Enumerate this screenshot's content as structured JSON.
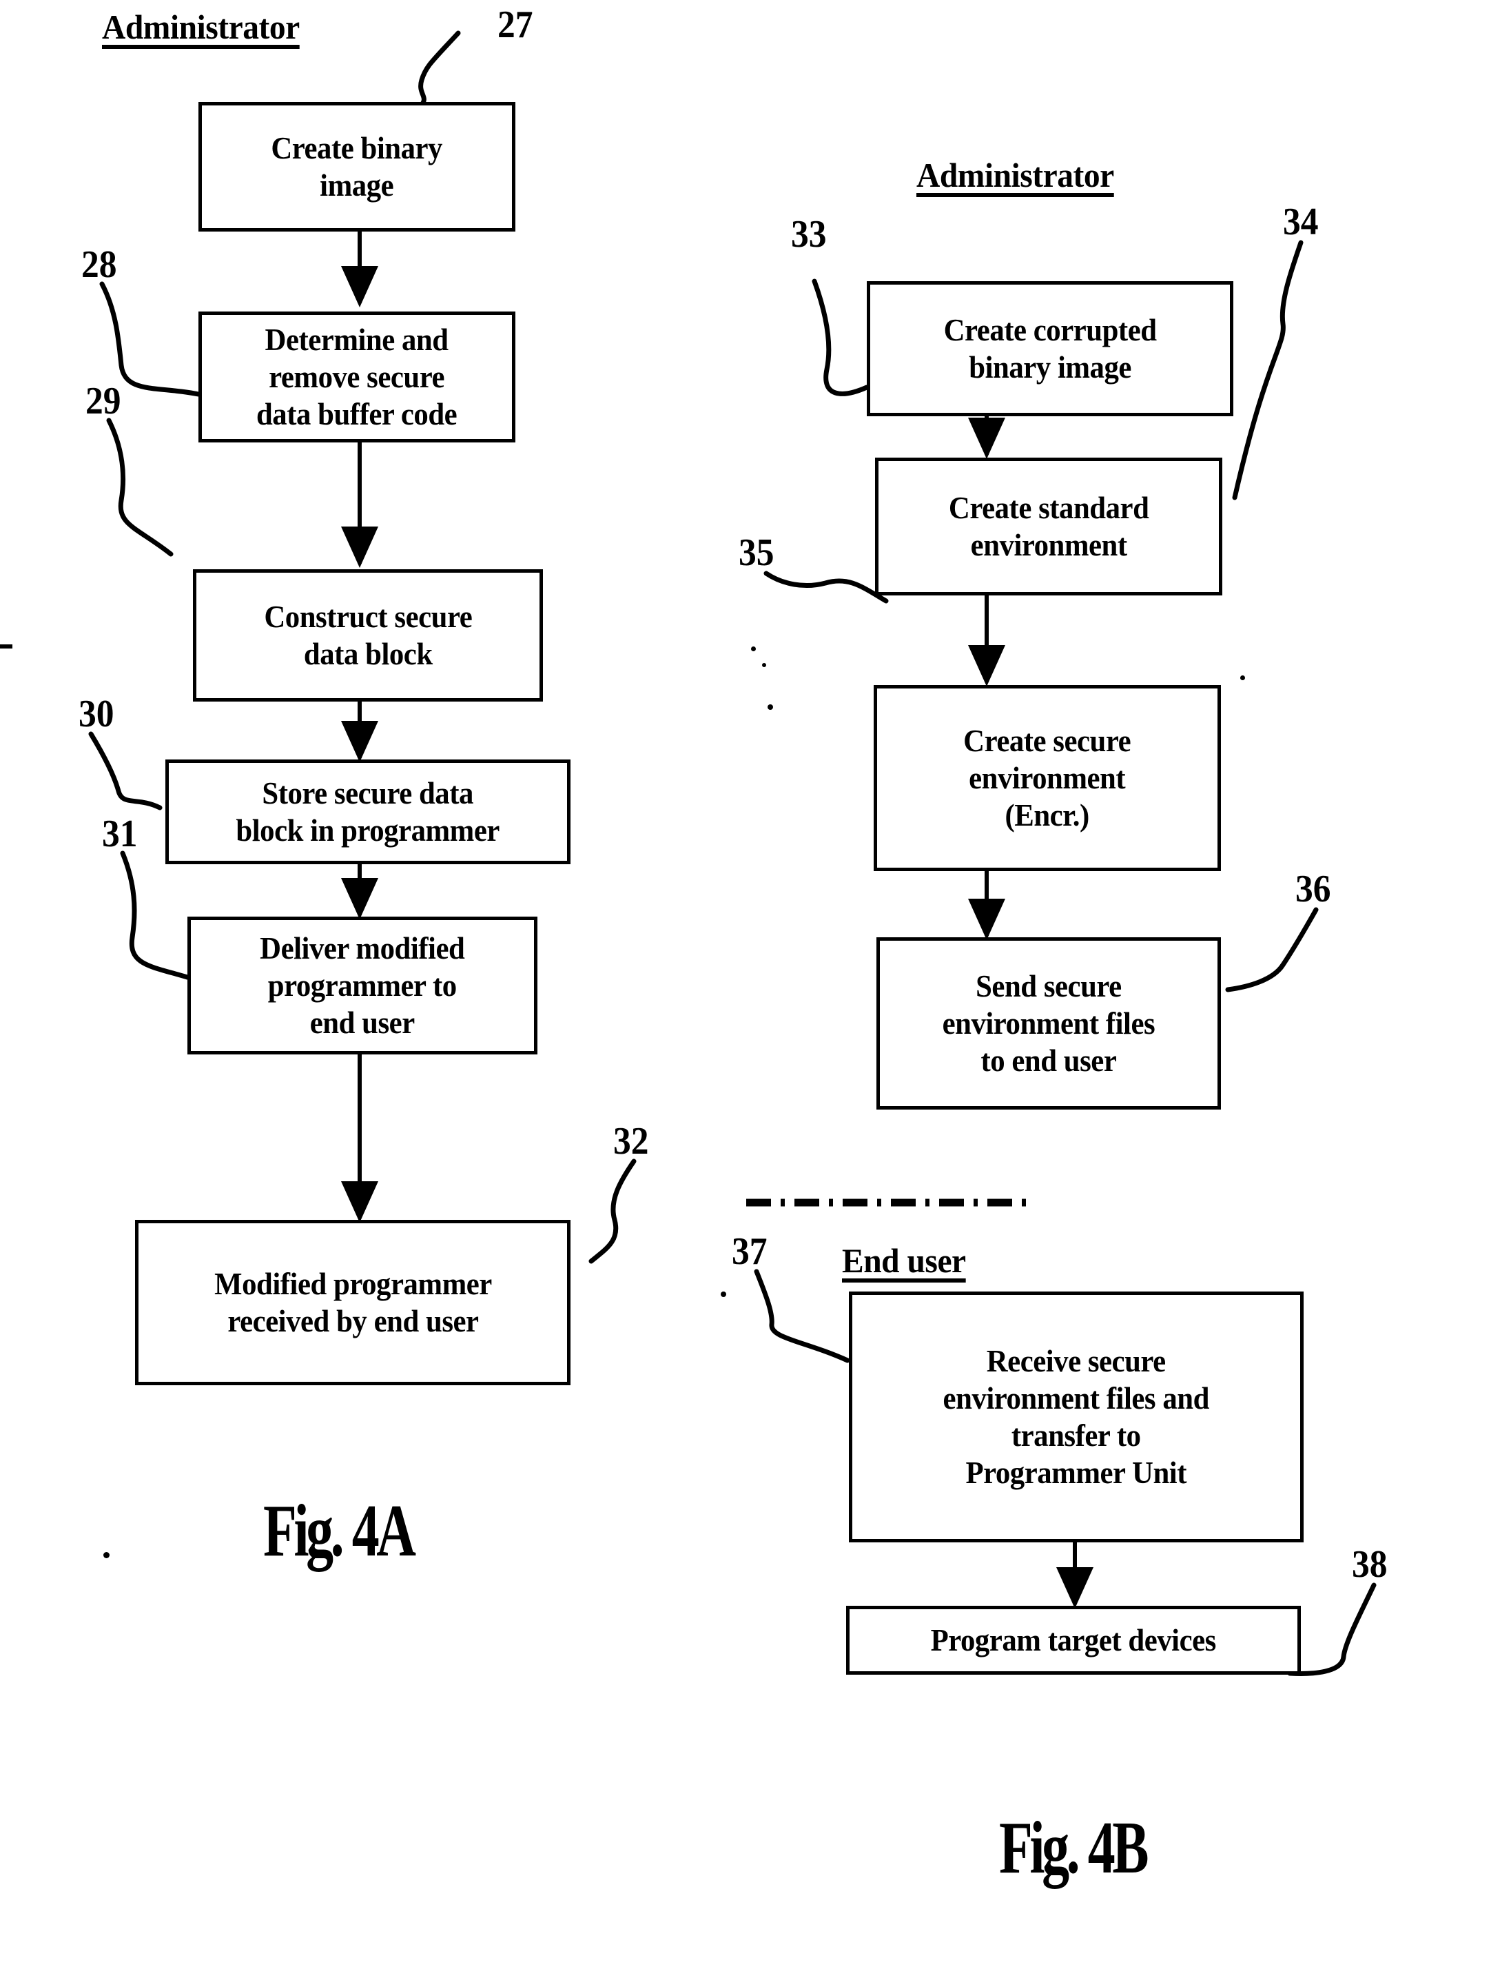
{
  "figures": [
    {
      "id": "fig-4a",
      "caption": "Fig. 4A",
      "lanes": [
        {
          "id": "administrator",
          "label": "Administrator"
        }
      ],
      "steps": [
        {
          "ref": "27",
          "text": "Create binary\nimage"
        },
        {
          "ref": "28",
          "text": "Determine and\nremove secure\ndata buffer code"
        },
        {
          "ref": "29",
          "text": "Construct secure\ndata block"
        },
        {
          "ref": "30",
          "text": "Store secure data\nblock in programmer"
        },
        {
          "ref": "31",
          "text": "Deliver modified\nprogrammer to\nend user"
        },
        {
          "ref": "32",
          "text": "Modified programmer\nreceived by end user"
        }
      ]
    },
    {
      "id": "fig-4b",
      "caption": "Fig. 4B",
      "lanes": [
        {
          "id": "administrator",
          "label": "Administrator"
        },
        {
          "id": "end-user",
          "label": "End user"
        }
      ],
      "steps": [
        {
          "ref": "33",
          "text": "Create corrupted\nbinary image"
        },
        {
          "ref": "34",
          "text": "Create standard\nenvironment"
        },
        {
          "ref": "35",
          "text": "Create secure\nenvironment\n(Encr.)"
        },
        {
          "ref": "36",
          "text": "Send secure\nenvironment files\nto end user"
        },
        {
          "ref": "37",
          "text": "Receive secure\nenvironment files and\ntransfer to\nProgrammer Unit"
        },
        {
          "ref": "38",
          "text": "Program target devices"
        }
      ]
    }
  ],
  "boxes": {
    "b27": {
      "line1": "Create binary",
      "line2": "image"
    },
    "b28": {
      "line1": "Determine and",
      "line2": "remove secure",
      "line3": "data buffer code"
    },
    "b29": {
      "line1": "Construct secure",
      "line2": "data block"
    },
    "b30": {
      "line1": "Store secure data",
      "line2": "block in programmer"
    },
    "b31": {
      "line1": "Deliver modified",
      "line2": "programmer to",
      "line3": "end user"
    },
    "b32": {
      "line1": "Modified programmer",
      "line2": "received by end user"
    },
    "b33": {
      "line1": "Create corrupted",
      "line2": "binary image"
    },
    "b34": {
      "line1": "Create standard",
      "line2": "environment"
    },
    "b35": {
      "line1": "Create secure",
      "line2": "environment",
      "line3": "(Encr.)"
    },
    "b36": {
      "line1": "Send secure",
      "line2": "environment files",
      "line3": "to end user"
    },
    "b37": {
      "line1": "Receive secure",
      "line2": "environment files and",
      "line3": "transfer to",
      "line4": "Programmer Unit"
    },
    "b38": {
      "line1": "Program target devices"
    }
  },
  "labels": {
    "admin_left": "Administrator",
    "admin_right": "Administrator",
    "end_user": "End user",
    "n27": "27",
    "n28": "28",
    "n29": "29",
    "n30": "30",
    "n31": "31",
    "n32": "32",
    "n33": "33",
    "n34": "34",
    "n35": "35",
    "n36": "36",
    "n37": "37",
    "n38": "38",
    "fig4a": "Fig. 4A",
    "fig4b": "Fig. 4B"
  },
  "style": {
    "ink": "#000000",
    "paper": "#ffffff"
  }
}
